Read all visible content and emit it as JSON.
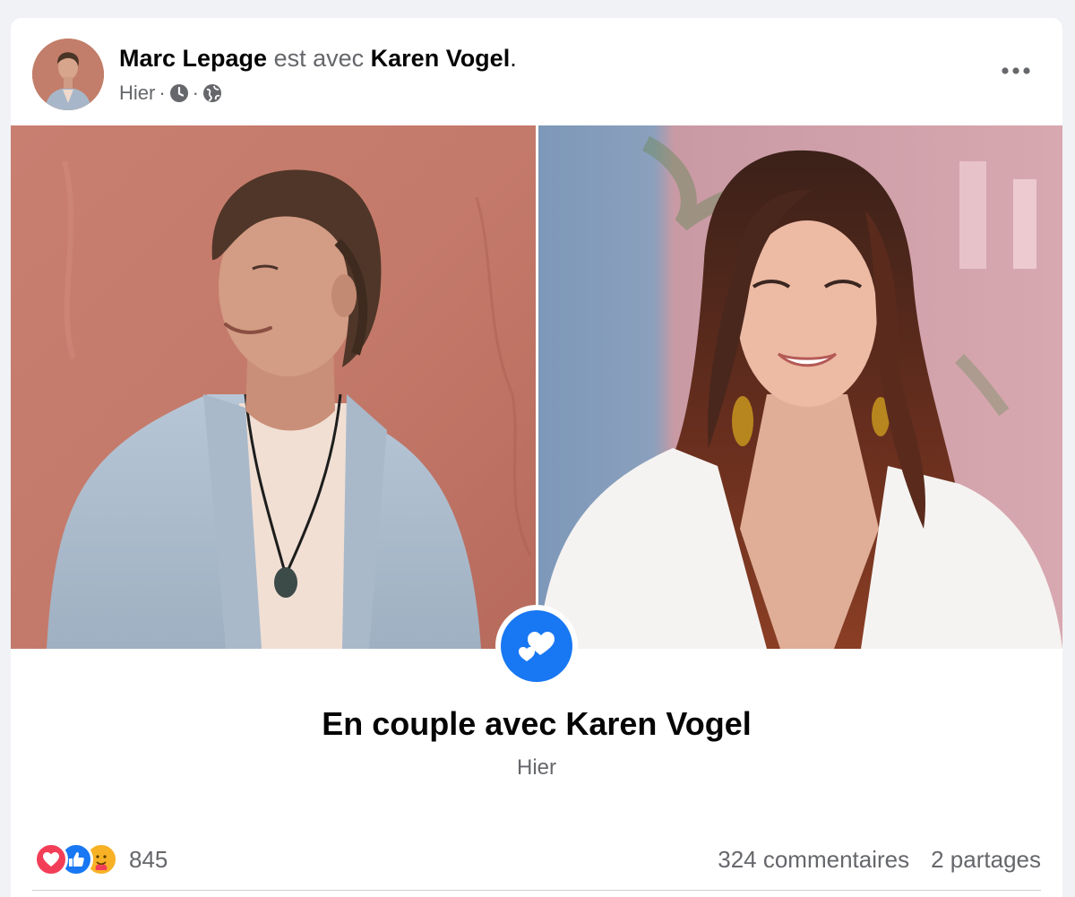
{
  "post": {
    "author": "Marc Lepage",
    "with_text": "est avec",
    "tagged": "Karen Vogel",
    "period": ".",
    "time": "Hier",
    "separator": "·",
    "more_icon": "more-horizontal-icon",
    "clock_icon": "clock-icon",
    "audience_icon": "globe-icon"
  },
  "life_event": {
    "icon": "hearts-icon",
    "title": "En couple avec Karen Vogel",
    "date": "Hier"
  },
  "stats": {
    "reactions": [
      "love-reaction-icon",
      "like-reaction-icon",
      "care-reaction-icon"
    ],
    "reaction_count": "845",
    "comments": "324 commentaires",
    "shares": "2 partages"
  },
  "colors": {
    "accent": "#1877f2",
    "love": "#f33e58",
    "care": "#f7b125",
    "muted": "#65676b",
    "text": "#050505"
  }
}
